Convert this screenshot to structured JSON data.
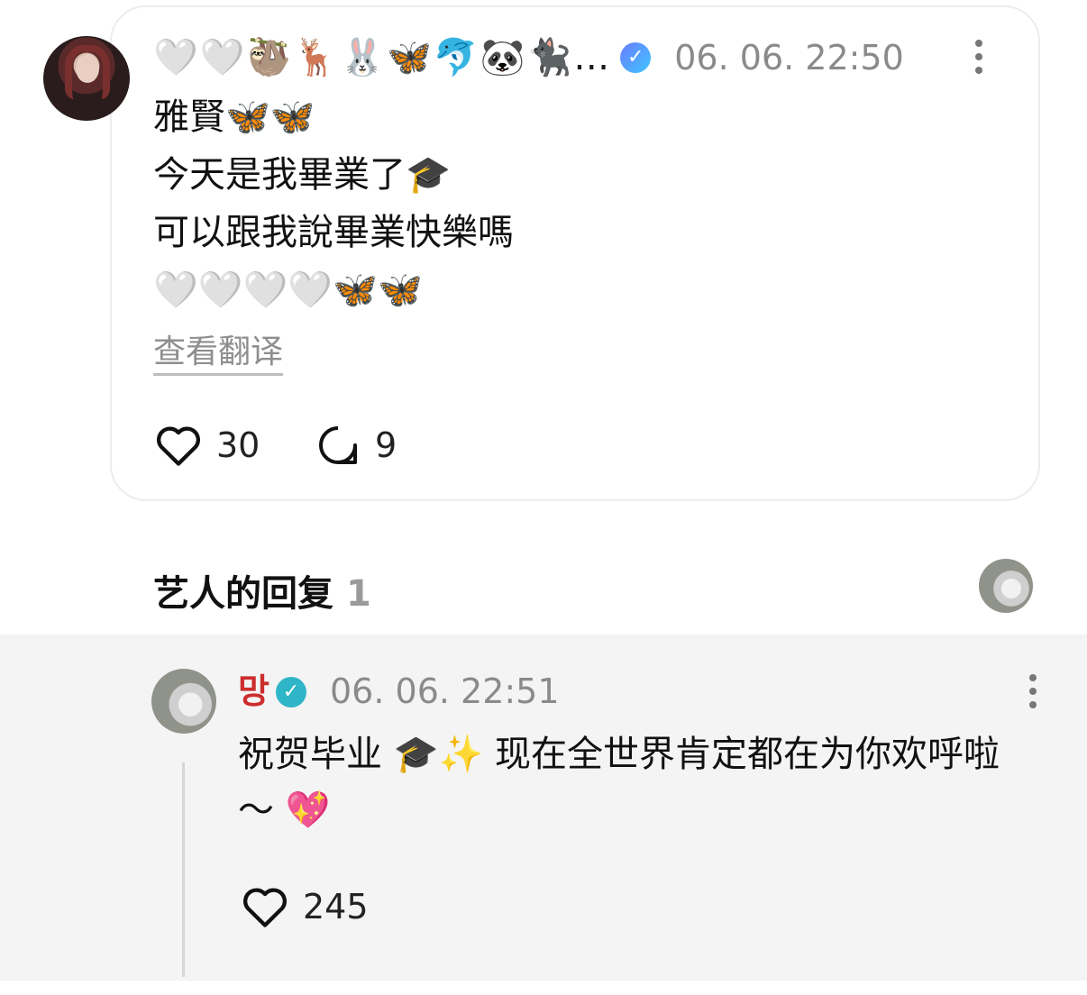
{
  "post": {
    "author_display": "🤍🤍🦥🦌🐰🦋🐬🐼🐈‍⬛…",
    "timestamp": "06. 06. 22:50",
    "lines": [
      "雅賢🦋🦋",
      "今天是我畢業了🎓",
      "可以跟我說畢業快樂嗎",
      "🤍🤍🤍🤍🦋🦋"
    ],
    "translate_label": "查看翻译",
    "like_count": "30",
    "comment_count": "9"
  },
  "artist_replies": {
    "title": "艺人的回复",
    "count": "1"
  },
  "reply": {
    "author": "망",
    "timestamp": "06. 06. 22:51",
    "text": "祝贺毕业 🎓✨ 现在全世界肯定都在为你欢呼啦～ 💖",
    "like_count": "245"
  },
  "colors": {
    "reply_author": "#cc2d2d",
    "reply_background": "#f4f4f4",
    "timestamp": "#8a8a8a"
  }
}
